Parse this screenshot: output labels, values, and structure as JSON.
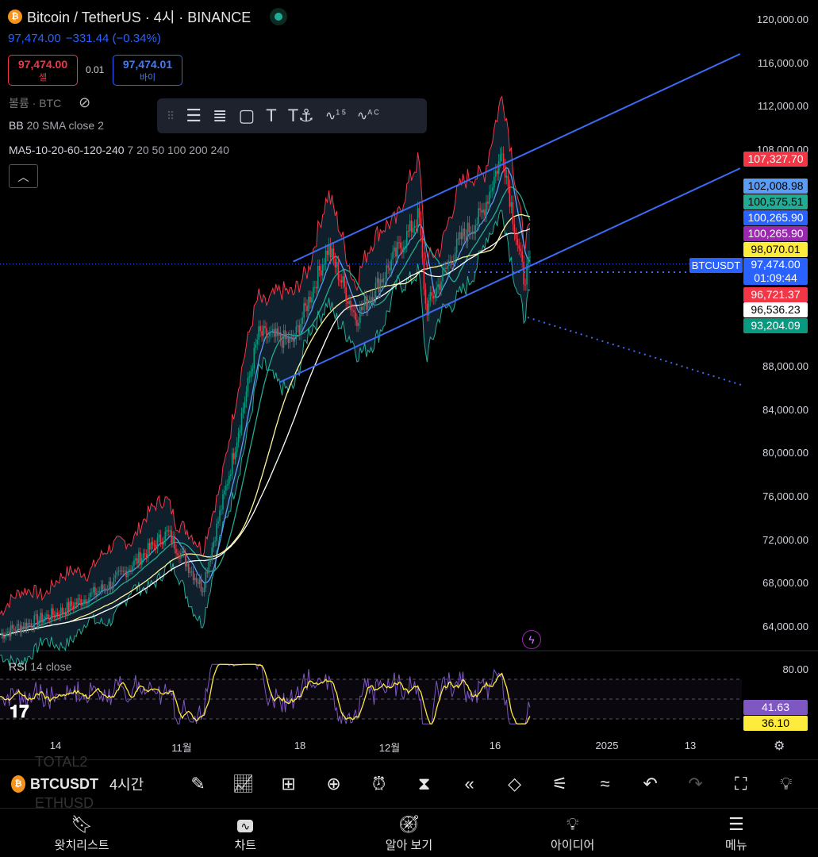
{
  "header": {
    "title": "Bitcoin / TetherUS · 4시 · BINANCE",
    "last_price": "97,474.00",
    "change": "−331.44 (−0.34%)",
    "market_status": "open"
  },
  "trade": {
    "sell_price": "97,474.00",
    "sell_label": "셀",
    "spread": "0.01",
    "buy_price": "97,474.01",
    "buy_label": "바이"
  },
  "indicators": {
    "volume": "볼륨 · BTC",
    "bb_name": "BB",
    "bb_params": "20 SMA close 2",
    "ma_name": "MA5-10-20-60-120-240",
    "ma_params": "7 20 50 100 200 240",
    "rsi_name": "RSI",
    "rsi_params": "14 close"
  },
  "drawing_toolbar": {
    "icons": [
      "drag-handle",
      "horizontal-lines",
      "fib-retracement",
      "rectangle",
      "text",
      "anchored-text",
      "elliott-wave-15",
      "abc-pattern"
    ],
    "labels": [
      "T",
      "T",
      "1",
      "5",
      "A",
      "C"
    ]
  },
  "price_axis": [
    "120,000.00",
    "116,000.00",
    "112,000.00",
    "108,000.00",
    "88,000.00",
    "84,000.00",
    "80,000.00",
    "76,000.00",
    "72,000.00",
    "68,000.00",
    "64,000.00"
  ],
  "price_tags": [
    {
      "text": "107,327.70",
      "bg": "#f23645",
      "fg": "#ffffff",
      "price": 107327.7
    },
    {
      "text": "102,008.98",
      "bg": "#5b9cf6",
      "fg": "#000000",
      "price": 102008.98
    },
    {
      "text": "100,575.51",
      "bg": "#22ab94",
      "fg": "#000000",
      "price": 100575.51
    },
    {
      "text": "100,265.90",
      "bg": "#2962ff",
      "fg": "#ffffff",
      "price": 100265.9
    },
    {
      "text": "100,265.90",
      "bg": "#9c27b0",
      "fg": "#ffffff",
      "price": 100265.9
    },
    {
      "text": "98,070.01",
      "bg": "#ffeb3b",
      "fg": "#000000",
      "price": 98070.01
    },
    {
      "text": "97,474.00",
      "bg": "#2962ff",
      "fg": "#ffffff",
      "price": 97474
    },
    {
      "text": "96,721.37",
      "bg": "#f23645",
      "fg": "#ffffff",
      "price": 96721.37
    },
    {
      "text": "96,536.23",
      "bg": "#ffffff",
      "fg": "#000000",
      "price": 96536.23
    },
    {
      "text": "93,204.09",
      "bg": "#089981",
      "fg": "#ffffff",
      "price": 93204.09
    }
  ],
  "countdown": "01:09:44",
  "symbol_tag": "BTCUSDT",
  "rsi_axis": [
    "80.00"
  ],
  "rsi_tags": [
    {
      "text": "41.63",
      "bg": "#7e57c2",
      "fg": "#ffffff"
    },
    {
      "text": "36.10",
      "bg": "#ffeb3b",
      "fg": "#000000"
    }
  ],
  "time_axis": [
    "14",
    "11월",
    "18",
    "12월",
    "16",
    "2025",
    "13"
  ],
  "bottom_toolbar": {
    "symbol": "BTCUSDT",
    "timeframe": "4시간",
    "ghost_above": "TOTAL2",
    "ghost_below": "ETHUSD",
    "icons": [
      "pencil",
      "indicators",
      "templates",
      "add",
      "alert",
      "candles",
      "replay",
      "layers",
      "settings",
      "pattern",
      "undo",
      "redo",
      "fullscreen",
      "ideas"
    ]
  },
  "nav": [
    {
      "label": "왓치리스트",
      "icon": "watchlist-icon"
    },
    {
      "label": "차트",
      "icon": "chart-icon"
    },
    {
      "label": "알아 보기",
      "icon": "compass-icon"
    },
    {
      "label": "아이디어",
      "icon": "lightbulb-icon"
    },
    {
      "label": "메뉴",
      "icon": "menu-icon"
    }
  ],
  "colors": {
    "background": "#000000",
    "up": "#089981",
    "down": "#f23645",
    "channel": "#3d6af2",
    "ma_yellow": "#fff59d",
    "ma_white": "#ffffff",
    "rsi": "#7e57c2"
  },
  "chart_data": {
    "type": "candlestick",
    "symbol": "BTCUSDT",
    "interval": "4h",
    "ylim": [
      62000,
      121000
    ],
    "x": [
      "2024-10-06",
      "2024-10-15",
      "2024-10-22",
      "2024-10-30",
      "2024-11-04",
      "2024-11-08",
      "2024-11-12",
      "2024-11-17",
      "2024-11-22",
      "2024-11-26",
      "2024-11-30",
      "2024-12-05",
      "2024-12-06",
      "2024-12-11",
      "2024-12-14",
      "2024-12-17",
      "2024-12-19",
      "2024-12-20",
      "2024-12-20"
    ],
    "close": [
      63300,
      65500,
      68000,
      72700,
      67600,
      78600,
      91000,
      90300,
      99000,
      92500,
      96500,
      102000,
      93200,
      99800,
      102000,
      107900,
      99800,
      96200,
      97474
    ],
    "channel_upper": [
      [
        "2024-11-17",
        97700
      ],
      [
        "2025-01-20",
        116850
      ]
    ],
    "channel_lower": [
      [
        "2024-11-15",
        86550
      ],
      [
        "2025-01-20",
        106300
      ]
    ],
    "rsi": {
      "levels": [
        70,
        50,
        30
      ],
      "last": 41.63,
      "ma_last": 36.1
    }
  }
}
